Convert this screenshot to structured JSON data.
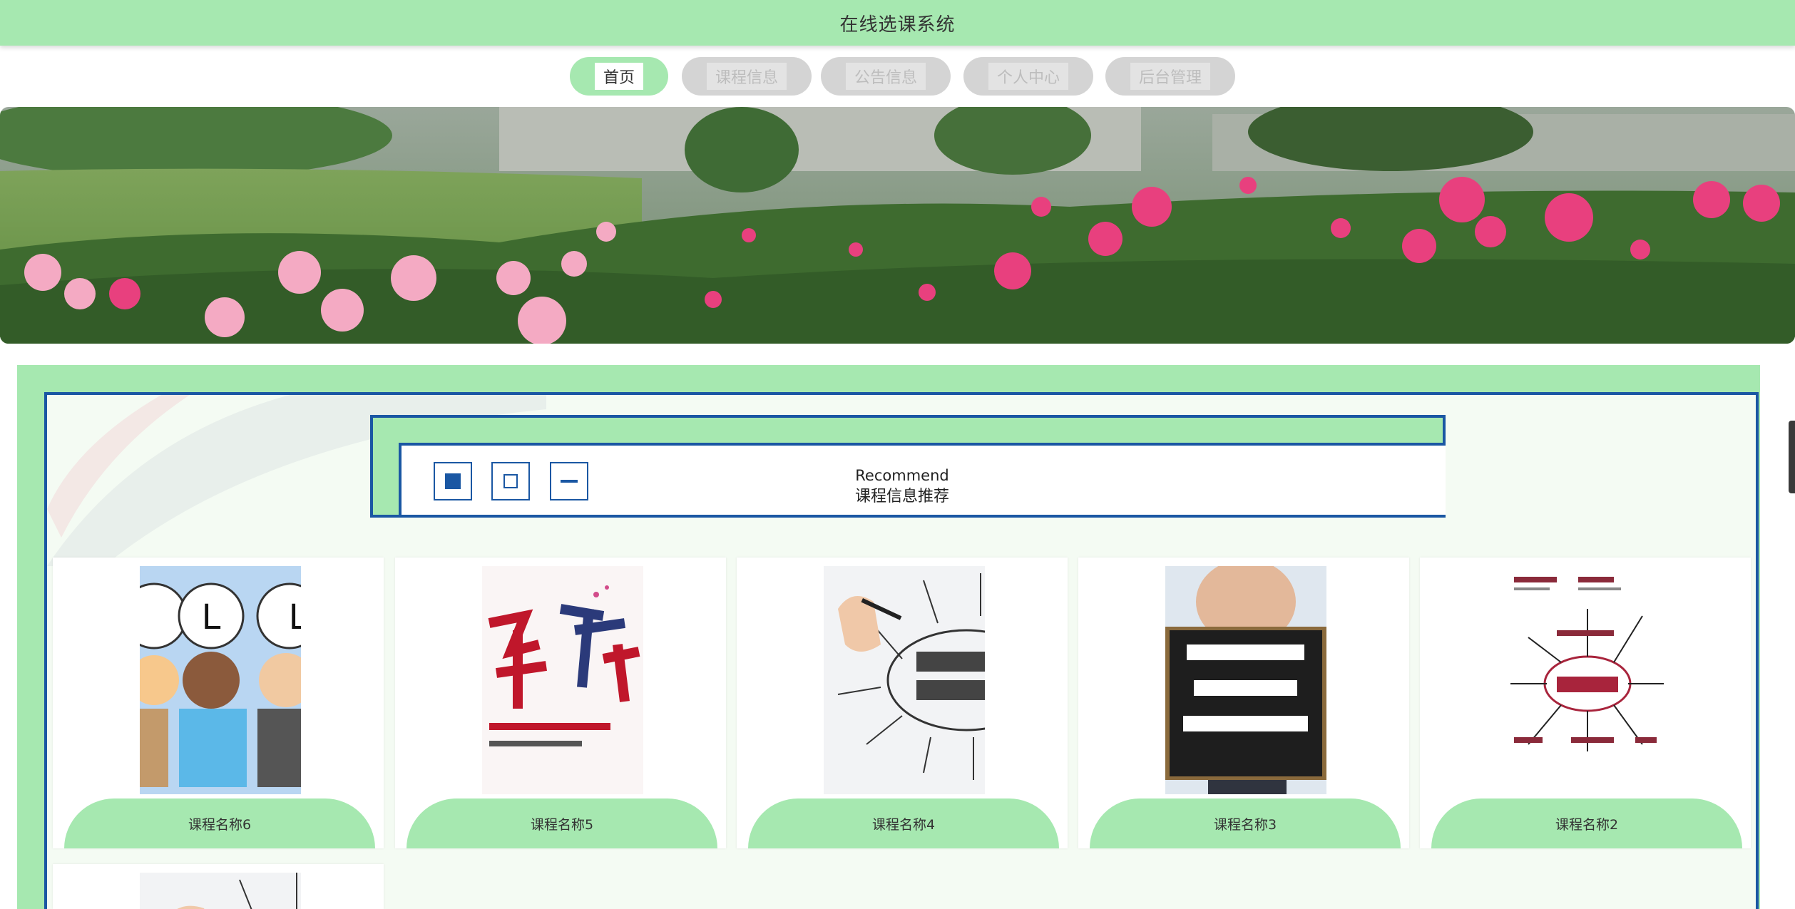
{
  "header": {
    "title": "在线选课系统"
  },
  "nav": {
    "items": [
      {
        "label": "首页",
        "active": true
      },
      {
        "label": "课程信息",
        "active": false
      },
      {
        "label": "公告信息",
        "active": false
      },
      {
        "label": "个人中心",
        "active": false
      },
      {
        "label": "后台管理",
        "active": false
      }
    ]
  },
  "banner": {
    "image": "peony-garden-photo"
  },
  "recommend": {
    "title_en": "Recommend",
    "title_cn": "课程信息推荐",
    "controls": [
      "filled-square-icon",
      "empty-square-icon",
      "minus-icon"
    ]
  },
  "courses": [
    {
      "name": "课程名称6",
      "image": "cartoon-people-balloons"
    },
    {
      "name": "课程名称5",
      "image": "calligraphy-poster"
    },
    {
      "name": "课程名称4",
      "image": "business-training-diagram"
    },
    {
      "name": "课程名称3",
      "image": "chalkboard"
    },
    {
      "name": "课程名称2",
      "image": "have-word-diagram"
    },
    {
      "name": "",
      "image": "partial-sketch"
    }
  ],
  "colors": {
    "accent_green": "#a6e8b0",
    "frame_blue": "#1a57a3"
  }
}
